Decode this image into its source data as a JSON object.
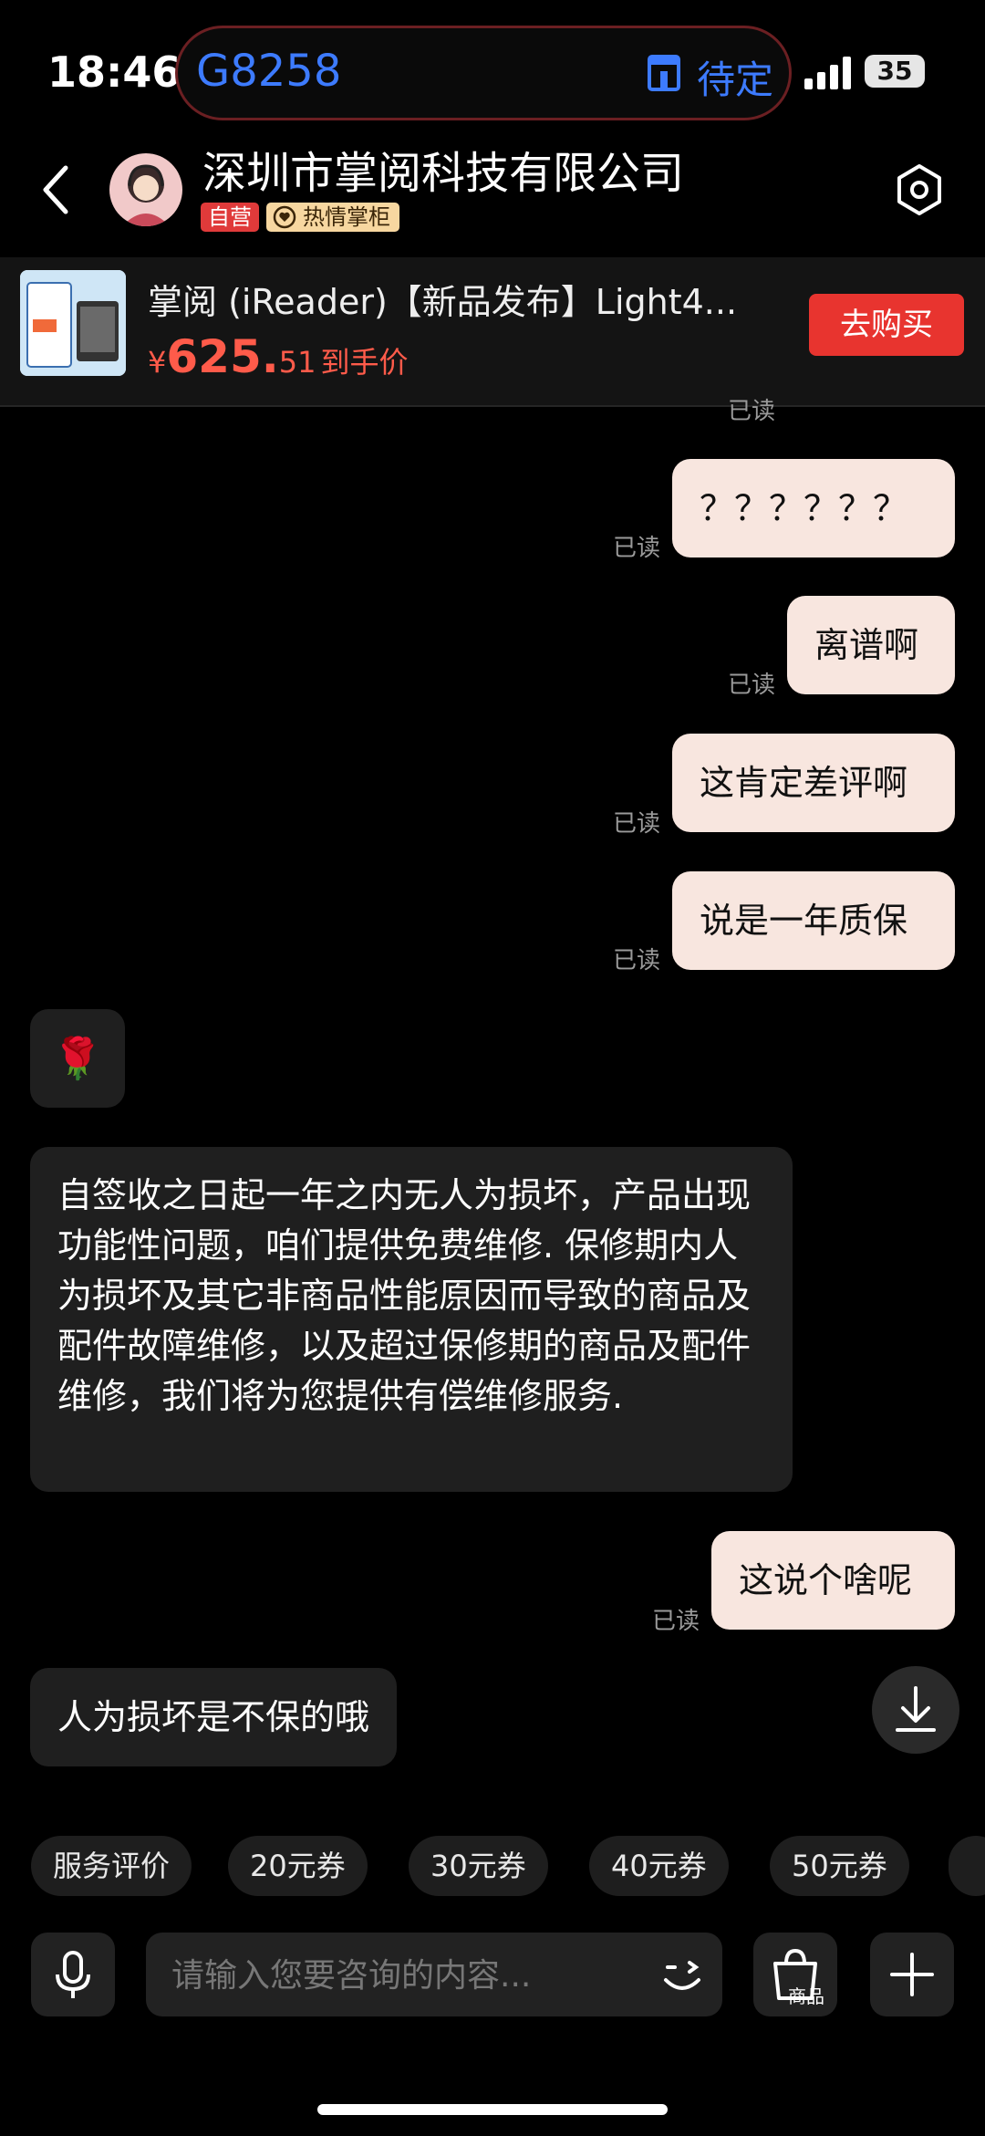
{
  "status": {
    "time": "18:46",
    "flight_no": "G8258",
    "flight_status": "待定",
    "battery": "35"
  },
  "header": {
    "shop_name": "深圳市掌阅科技有限公司",
    "tag_self": "自营",
    "tag_hot": "热情掌柜"
  },
  "product": {
    "title": "掌阅 (iReader)【新品发布】Light4...",
    "currency": "¥",
    "price_int": "625.",
    "price_dec": "51",
    "price_suffix": "到手价",
    "buy_label": "去购买"
  },
  "messages": {
    "m1": {
      "text": "？？？？？？",
      "read": "已读"
    },
    "m2": {
      "text": "离谱啊",
      "read": "已读"
    },
    "m3": {
      "text": "这肯定差评啊",
      "read": "已读"
    },
    "m4": {
      "text": "说是一年质保",
      "read": "已读"
    },
    "rose": "🌹",
    "reply_long": "自签收之日起一年之内无人为损坏，产品出现功能性问题，咱们提供免费维修. 保修期内人为损坏及其它非商品性能原因而导致的商品及配件故障维修，以及超过保修期的商品及配件维修，我们将为您提供有偿维修服务.",
    "m5": {
      "text": "这说个啥呢",
      "read": "已读"
    },
    "reply_last": "人为损坏是不保的哦"
  },
  "quick_actions": [
    "服务评价",
    "20元券",
    "30元券",
    "40元券",
    "50元券"
  ],
  "input": {
    "placeholder": "请输入您要咨询的内容...",
    "goods_label": "商品"
  }
}
